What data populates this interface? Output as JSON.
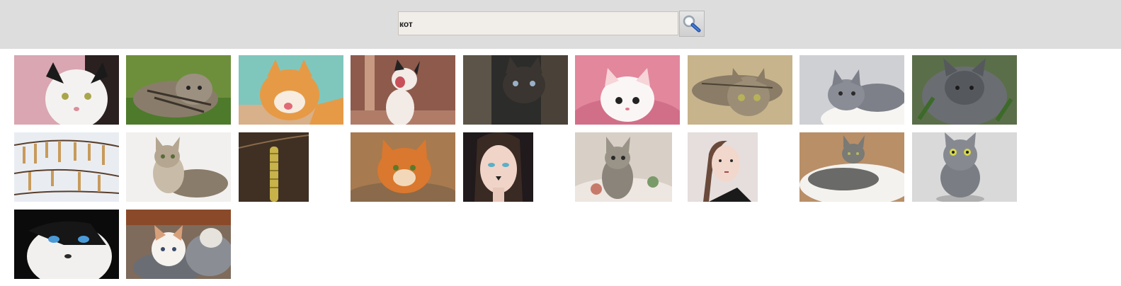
{
  "search": {
    "value": "кот",
    "button_icon": "search-icon"
  },
  "results": [
    {
      "name": "image-result-cat-white-black",
      "bg": "#d9a6b2"
    },
    {
      "name": "image-result-kitten-grass",
      "bg": "#6d8f3c"
    },
    {
      "name": "image-result-orange-cat-licking",
      "bg": "#7fc7bd"
    },
    {
      "name": "image-result-cat-yawning",
      "bg": "#8e5a4c"
    },
    {
      "name": "image-result-tabby-in-wood",
      "bg": "#2c2c2a"
    },
    {
      "name": "image-result-kitten-pink-blanket",
      "bg": "#e3879d"
    },
    {
      "name": "image-result-tabby-lying",
      "bg": "#c8b48c"
    },
    {
      "name": "image-result-grey-kitten",
      "bg": "#cfd0d4"
    },
    {
      "name": "image-result-grey-longhair-cat",
      "bg": "#5b6e4a"
    },
    {
      "name": "image-result-catkins-branch",
      "bg": "#e9edf2"
    },
    {
      "name": "image-result-tabby-kitten-white",
      "bg": "#f2f0ee"
    },
    {
      "name": "image-result-catkin-dark",
      "bg": "#3f3023"
    },
    {
      "name": "image-result-ginger-cat-basket",
      "bg": "#a87a4f"
    },
    {
      "name": "image-result-woman-cat-makeup",
      "bg": "#201a1c"
    },
    {
      "name": "image-result-tabby-kitten-bed",
      "bg": "#d8cfc6"
    },
    {
      "name": "image-result-woman-ponytail",
      "bg": "#e5dedd"
    },
    {
      "name": "image-result-tabby-on-rug",
      "bg": "#b98f68"
    },
    {
      "name": "image-result-grey-cat-portrait",
      "bg": "#d9d9d9"
    },
    {
      "name": "image-result-black-white-cat-dark",
      "bg": "#0b0b0b"
    },
    {
      "name": "image-result-kittens-in-shoes",
      "bg": "#7e6b5c"
    }
  ]
}
